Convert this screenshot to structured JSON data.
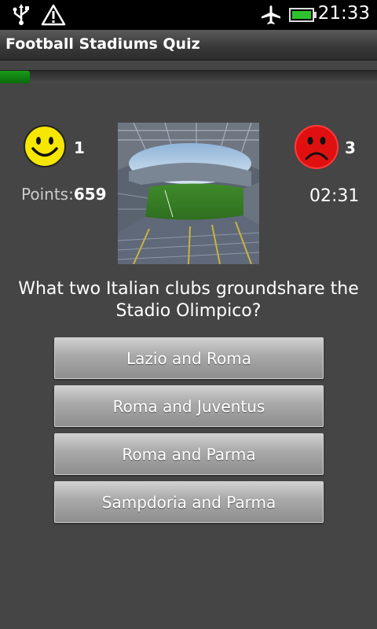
{
  "status_bar": {
    "time": "21:33",
    "icons": [
      "usb-icon",
      "warning-icon",
      "airplane-mode-icon",
      "battery-icon"
    ]
  },
  "app": {
    "title": "Football Stadiums Quiz"
  },
  "progress": {
    "fraction": 0.08
  },
  "scores": {
    "correct_count": "1",
    "wrong_count": "3",
    "points_label": "Points:",
    "points_value": "659",
    "timer": "02:31"
  },
  "question": {
    "text": "What two Italian clubs groundshare the Stadio Olimpico?"
  },
  "answers": [
    {
      "label": "Lazio and Roma"
    },
    {
      "label": "Roma and Juventus"
    },
    {
      "label": "Roma and Parma"
    },
    {
      "label": "Sampdoria and Parma"
    }
  ],
  "colors": {
    "background": "#454545",
    "progress_green": "#128a12",
    "smiley_yellow": "#f6e600",
    "frowny_red": "#e01010"
  }
}
